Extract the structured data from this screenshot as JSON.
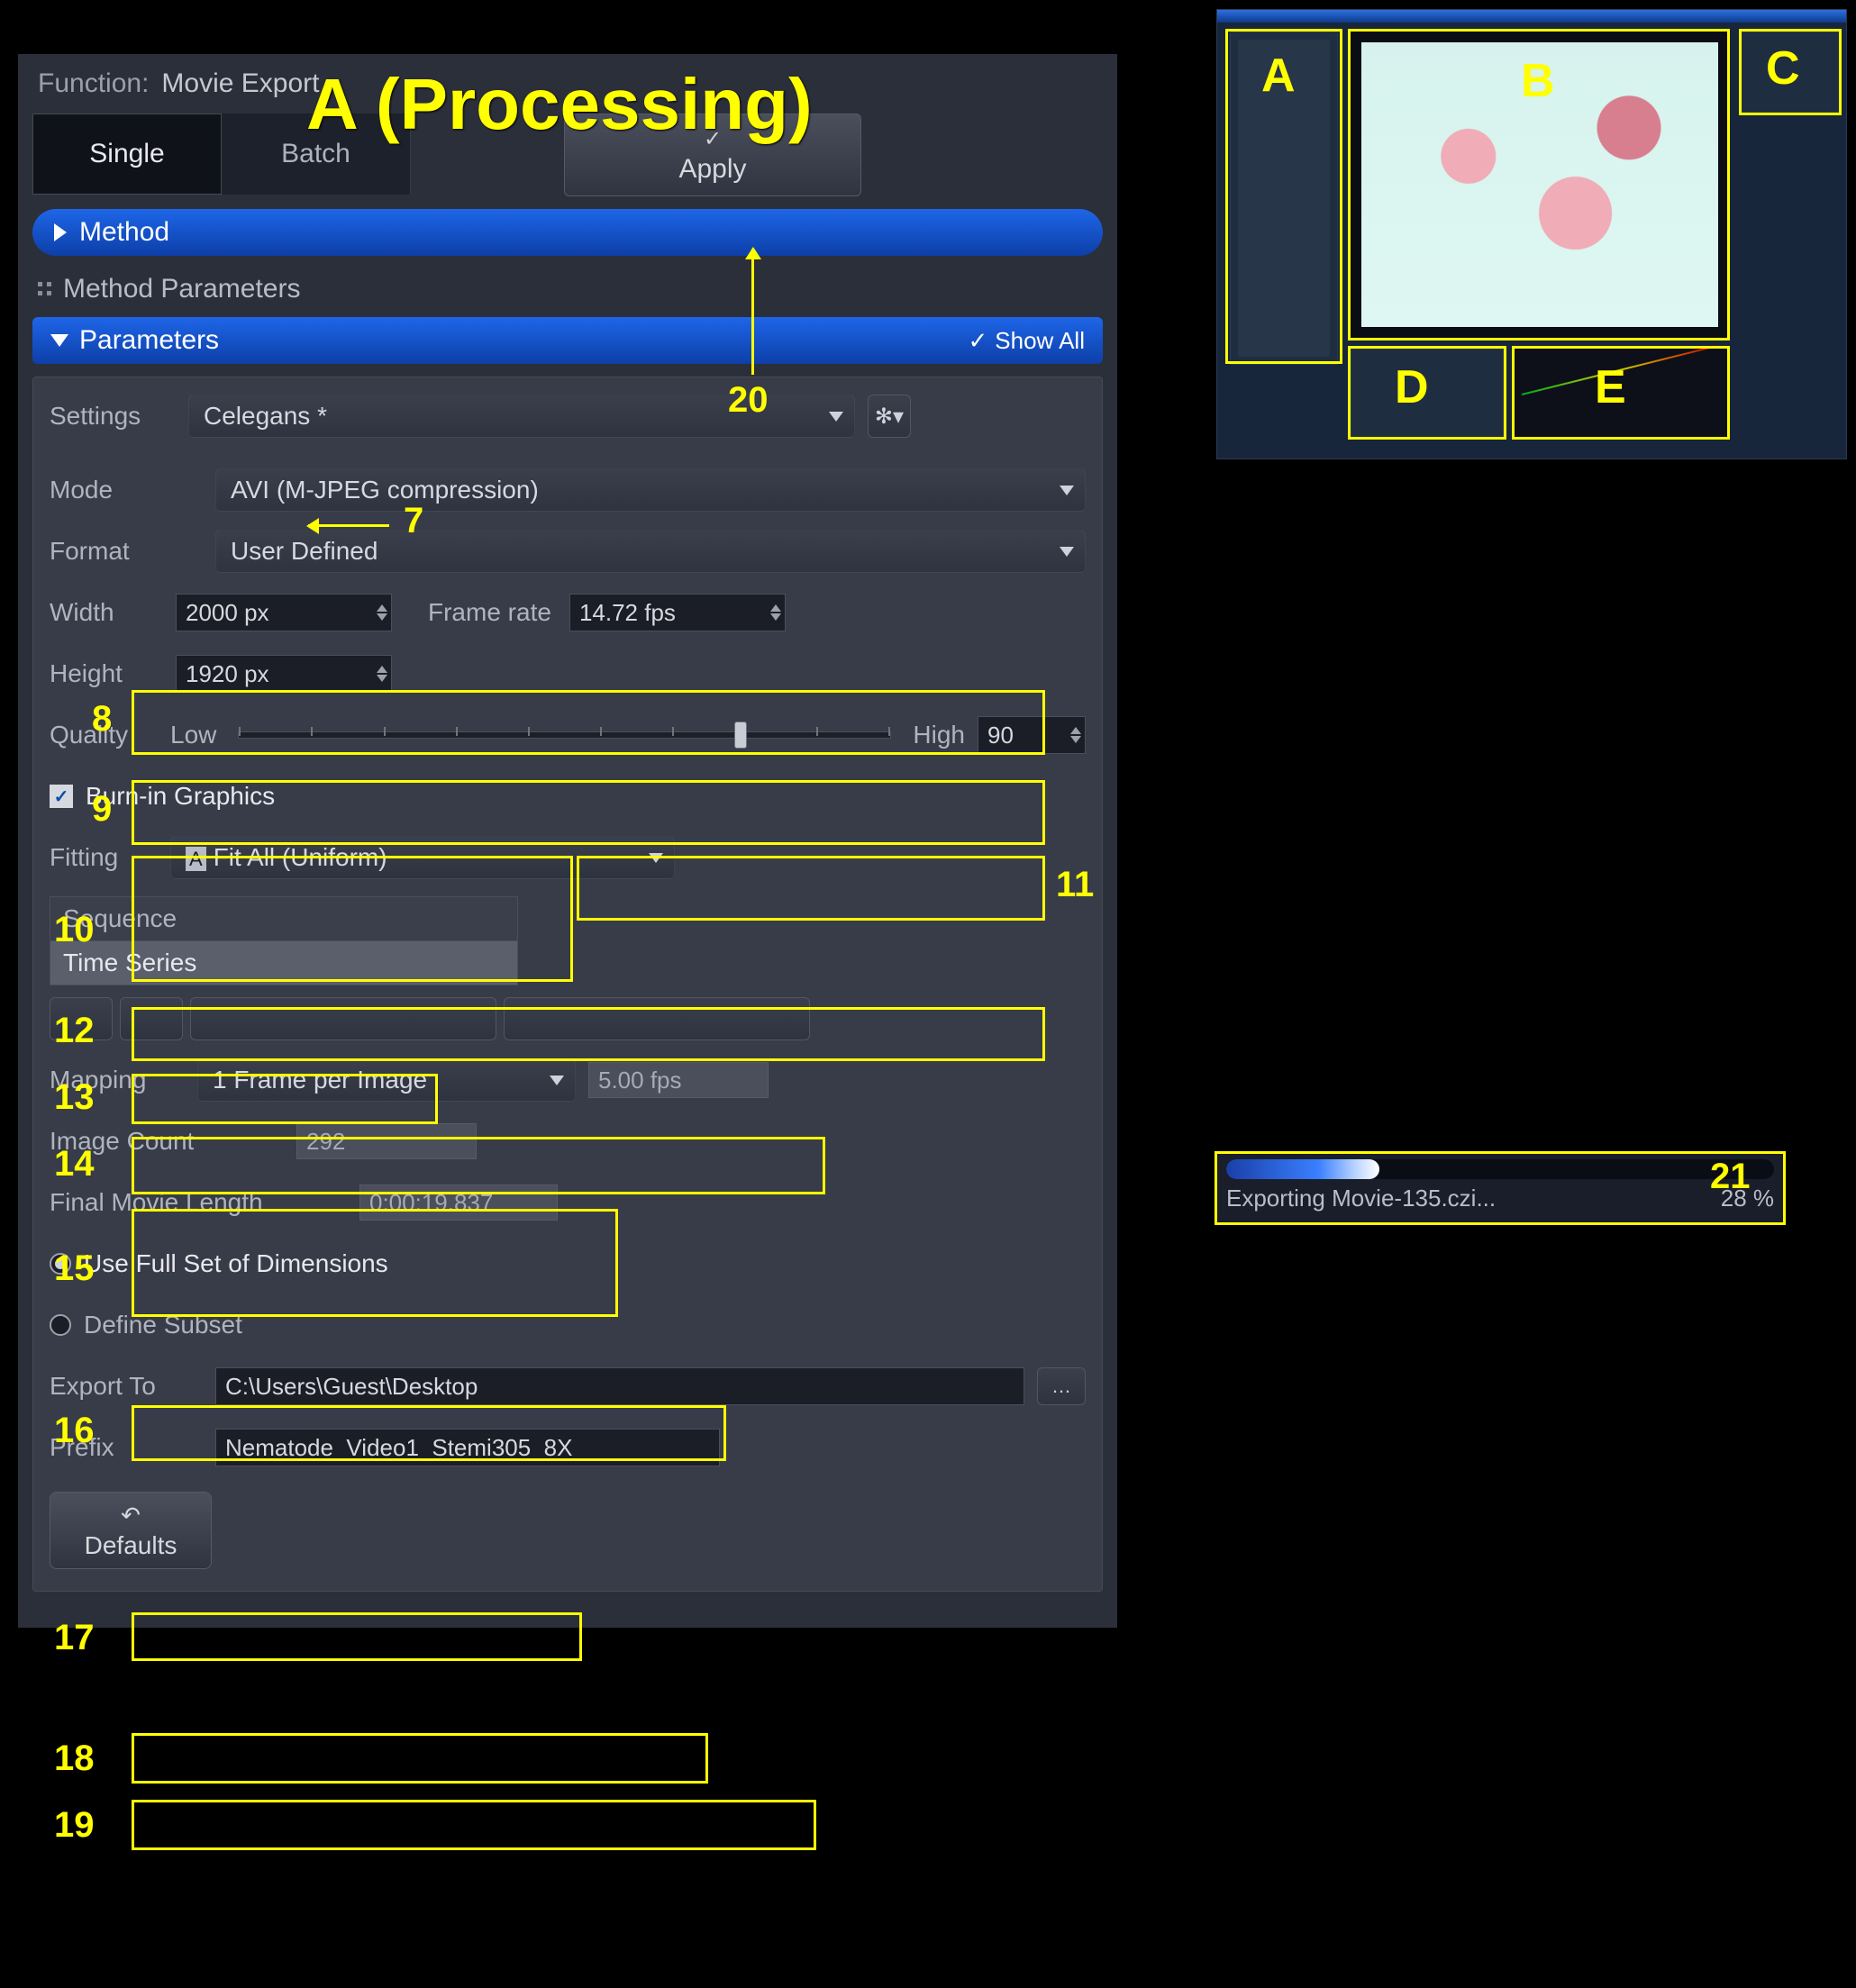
{
  "annotation": {
    "title": "A (Processing)"
  },
  "function": {
    "label": "Function:",
    "value": "Movie Export"
  },
  "tabs": {
    "single": "Single",
    "batch": "Batch"
  },
  "apply": {
    "label": "Apply"
  },
  "method": {
    "label": "Method"
  },
  "method_params": {
    "label": "Method Parameters"
  },
  "parameters": {
    "label": "Parameters",
    "showall": "Show All"
  },
  "settings": {
    "label": "Settings",
    "value": "Celegans *"
  },
  "mode": {
    "label": "Mode",
    "value": "AVI (M-JPEG compression)"
  },
  "format": {
    "label": "Format",
    "value": "User Defined"
  },
  "width": {
    "label": "Width",
    "value": "2000 px"
  },
  "height": {
    "label": "Height",
    "value": "1920 px"
  },
  "framerate": {
    "label": "Frame rate",
    "value": "14.72 fps"
  },
  "quality": {
    "label": "Quality",
    "low": "Low",
    "high": "High",
    "value": "90"
  },
  "burnin": {
    "label": "Burn-in Graphics"
  },
  "fitting": {
    "label": "Fitting",
    "value": "Fit All (Uniform)"
  },
  "sequence": {
    "hdr": "Sequence",
    "item": "Time Series"
  },
  "mapping": {
    "label": "Mapping",
    "value": "1 Frame per Image",
    "fps": "5.00 fps"
  },
  "image_count": {
    "label": "Image Count",
    "value": "292"
  },
  "final_len": {
    "label": "Final Movie Length",
    "value": "0:00:19.837"
  },
  "dims_full": {
    "label": "Use Full Set of Dimensions"
  },
  "dims_subset": {
    "label": "Define Subset"
  },
  "export_to": {
    "label": "Export To",
    "value": "C:\\Users\\Guest\\Desktop"
  },
  "prefix": {
    "label": "Prefix",
    "value": "Nematode_Video1_Stemi305_8X"
  },
  "defaults": {
    "label": "Defaults"
  },
  "progress": {
    "text": "Exporting Movie-135.czi...",
    "pct": "28 %"
  },
  "ov_letters": {
    "A": "A",
    "B": "B",
    "C": "C",
    "D": "D",
    "E": "E"
  },
  "nums": {
    "n7": "7",
    "n8": "8",
    "n9": "9",
    "n10": "10",
    "n11": "11",
    "n12": "12",
    "n13": "13",
    "n14": "14",
    "n15": "15",
    "n16": "16",
    "n17": "17",
    "n18": "18",
    "n19": "19",
    "n20": "20",
    "n21": "21"
  }
}
